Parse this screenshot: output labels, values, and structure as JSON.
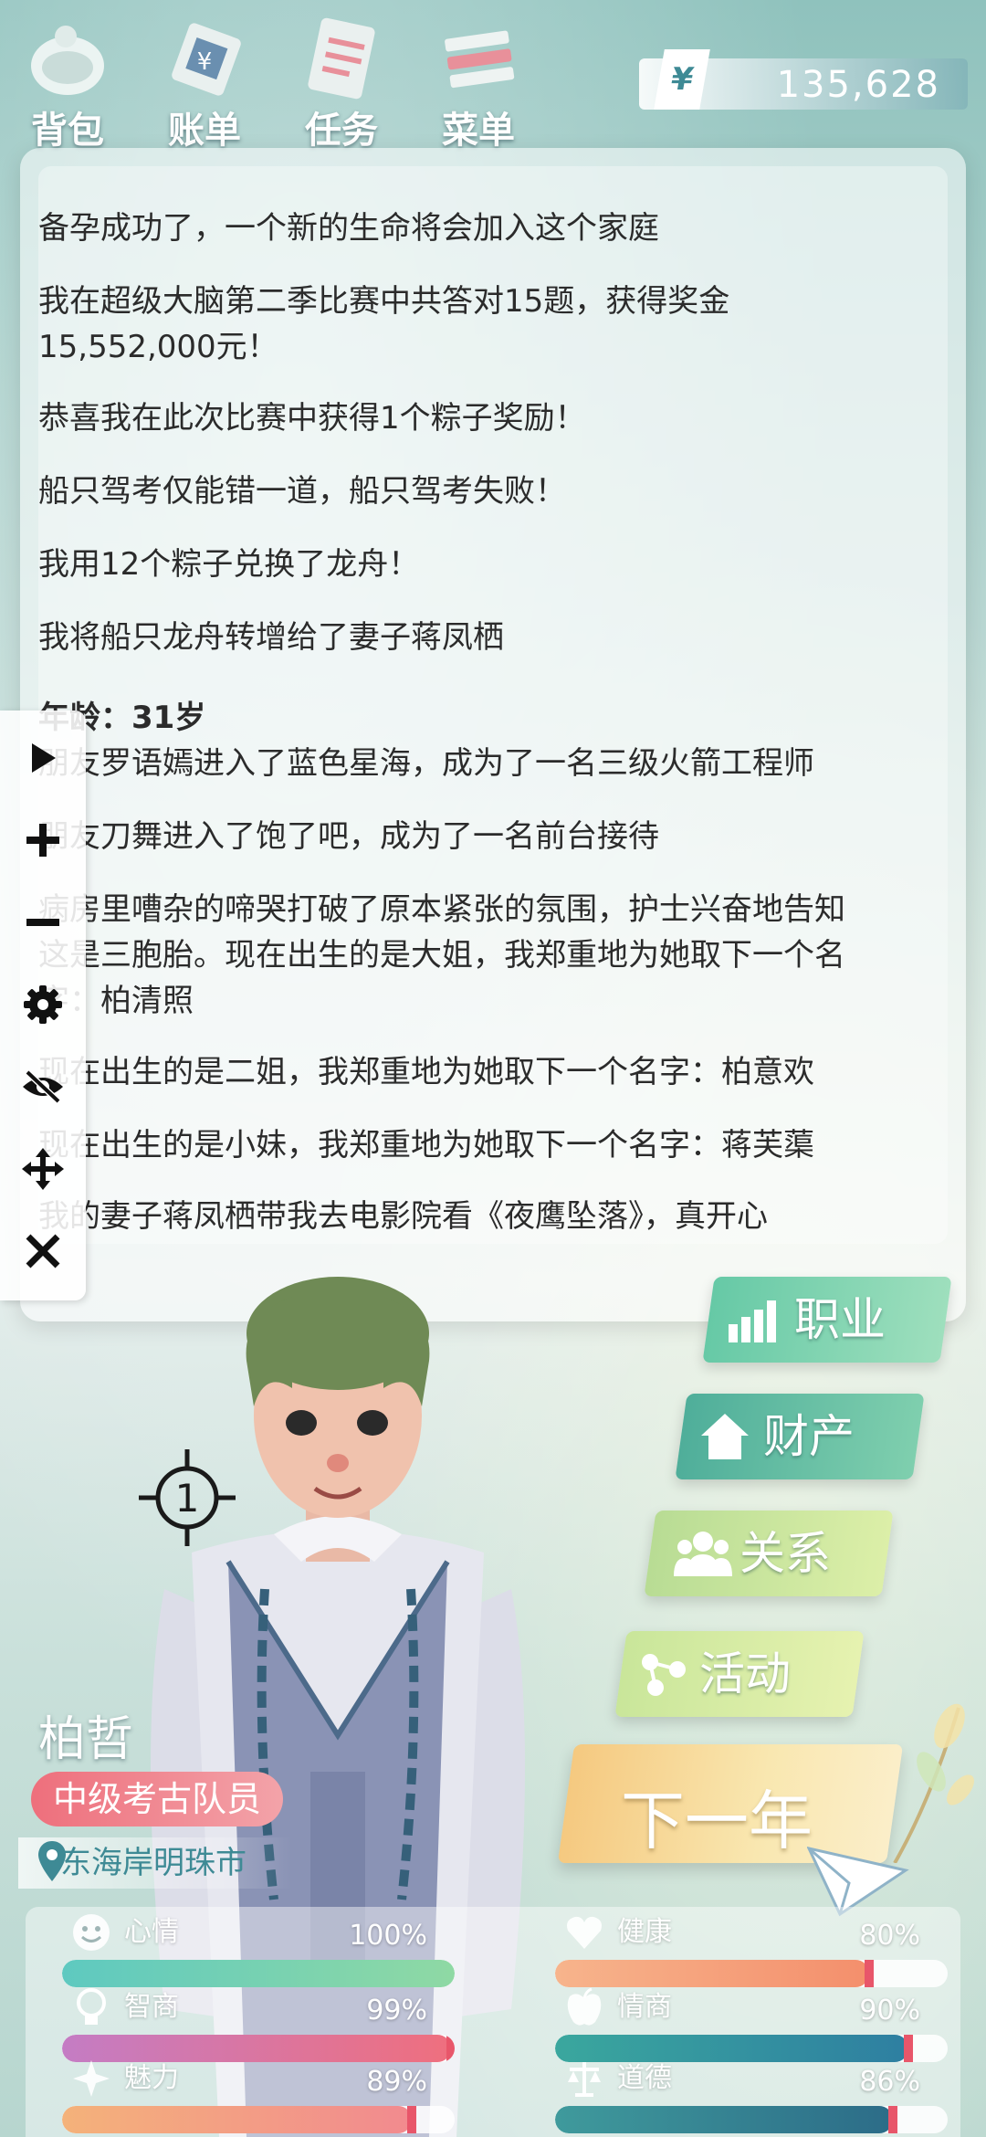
{
  "nav": {
    "items": [
      {
        "label": "背包",
        "icon": "bag-icon"
      },
      {
        "label": "账单",
        "icon": "bill-icon"
      },
      {
        "label": "任务",
        "icon": "task-icon"
      },
      {
        "label": "菜单",
        "icon": "menu-icon"
      }
    ],
    "currency_symbol": "¥",
    "money": "135,628"
  },
  "log": {
    "lines": [
      "备孕成功了，一个新的生命将会加入这个家庭",
      "我在超级大脑第二季比赛中共答对15题，获得奖金",
      "15,552,000元！",
      "恭喜我在此次比赛中获得1个粽子奖励！",
      "船只驾考仅能错一道，船只驾考失败！",
      "我用12个粽子兑换了龙舟！",
      "我将船只龙舟转增给了妻子蒋凤栖",
      "朋友罗语嫣进入了蓝色星海，成为了一名三级火箭工程师",
      "朋友刀舞进入了饱了吧，成为了一名前台接待",
      "病房里嘈杂的啼哭打破了原本紧张的氛围，护士兴奋地告知",
      "这是三胞胎。现在出生的是大姐，我郑重地为她取下一个名",
      "字：柏清照",
      "现在出生的是二姐，我郑重地为她取下一个名字：柏意欢",
      "现在出生的是小妹，我郑重地为她取下一个名字：蒋芙蕖",
      "我的妻子蒋凤栖带我去电影院看《夜鹰坠落》，真开心"
    ],
    "age_label": "年龄：",
    "age_value": "31岁"
  },
  "sidebar": {
    "buttons": [
      "play-icon",
      "plus-icon",
      "minus-icon",
      "gear-icon",
      "eye-off-icon",
      "move-icon",
      "close-icon"
    ]
  },
  "character": {
    "name": "柏哲",
    "job": "中级考古队员",
    "location": "东海岸明珠市",
    "crosshair_number": "1"
  },
  "actions": [
    {
      "label": "职业",
      "icon": "career-chart-icon"
    },
    {
      "label": "财产",
      "icon": "house-icon"
    },
    {
      "label": "关系",
      "icon": "people-icon"
    },
    {
      "label": "活动",
      "icon": "activity-icon"
    }
  ],
  "next_year": "下一年",
  "stats": [
    {
      "name": "心情",
      "value": "100%",
      "pct": 100,
      "icon": "smile-icon",
      "color_a": "#5ec9c0",
      "color_b": "#8fd9a4"
    },
    {
      "name": "健康",
      "value": "80%",
      "pct": 80,
      "icon": "heart-icon",
      "color_a": "#f7b48c",
      "color_b": "#f48f6c"
    },
    {
      "name": "智商",
      "value": "99%",
      "pct": 99,
      "icon": "bulb-icon",
      "color_a": "#c47cc4",
      "color_b": "#ef6f7e"
    },
    {
      "name": "情商",
      "value": "90%",
      "pct": 90,
      "icon": "apple-icon",
      "color_a": "#3aa79e",
      "color_b": "#2e7fa1"
    },
    {
      "name": "魅力",
      "value": "89%",
      "pct": 89,
      "icon": "sparkle-icon",
      "color_a": "#f4b27a",
      "color_b": "#f28a8f"
    },
    {
      "name": "道德",
      "value": "86%",
      "pct": 86,
      "icon": "scale-icon",
      "color_a": "#3f9a9c",
      "color_b": "#2c6c88"
    }
  ]
}
